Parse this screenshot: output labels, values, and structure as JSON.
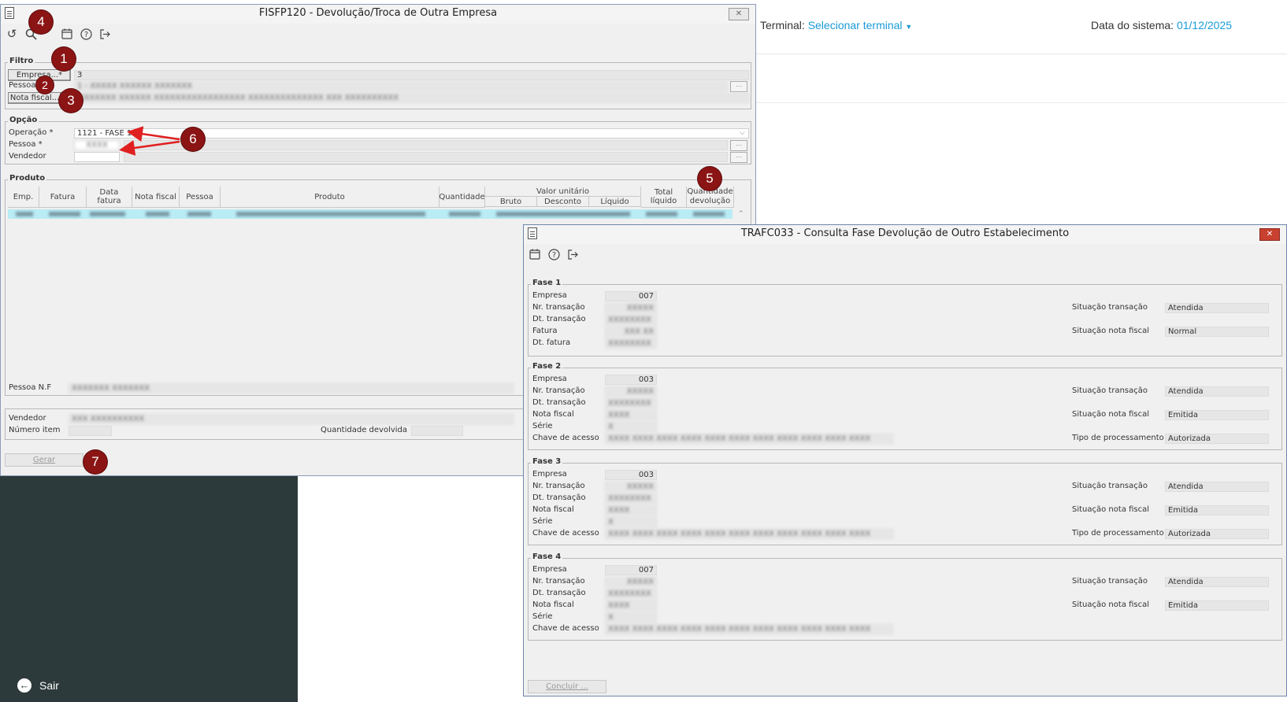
{
  "background": {
    "terminal_label": "Terminal:",
    "terminal_link": "Selecionar terminal",
    "date_label": "Data do sistema:",
    "date_value": "01/12/2025",
    "sair": "Sair"
  },
  "win1": {
    "title": "FISFP120 - Devolução/Troca de Outra Empresa",
    "close": "✕",
    "filtro": {
      "title": "Filtro",
      "empresa_button": "Empresa...*",
      "empresa_value": "3",
      "pessoa_label": "Pessoa",
      "pessoa_value": "1 - XXXXX XXXXXX XXXXXXX",
      "nota_button": "Nota fiscal...",
      "nota_value": "XXXXXXXXX XXXXXX XXXXXXXXXXXXXXXXX XXXXXXXXXXXXXX XXX XXXXXXXXXX"
    },
    "opcao": {
      "title": "Opção",
      "operacao_label": "Operação *",
      "operacao_value": "1121 - FASE 1",
      "pessoa_label": "Pessoa *",
      "pessoa_value": "XXXX",
      "vendedor_label": "Vendedor"
    },
    "produto": {
      "title": "Produto",
      "columns": [
        "Emp.",
        "Fatura",
        "Data fatura",
        "Nota fiscal",
        "Pessoa",
        "Produto",
        "Quantidade",
        "Valor unitário",
        "Total líquido",
        "Quantidade devolução"
      ],
      "sub_columns": [
        "Bruto",
        "Desconto",
        "Líquido"
      ],
      "pessoa_nf_label": "Pessoa N.F",
      "pessoa_nf_value": "XXXXXXX XXXXXXX"
    },
    "bottom": {
      "vendedor_label": "Vendedor",
      "vendedor_value": "XXX XXXXXXXXXX",
      "numero_item_label": "Número item",
      "qtd_devolvida_label": "Quantidade devolvida"
    },
    "gerar": "Gerar"
  },
  "win2": {
    "title": "TRAFC033 - Consulta Fase Devolução de Outro Estabelecimento",
    "close": "✕",
    "labels": {
      "empresa": "Empresa",
      "nr_transacao": "Nr. transação",
      "dt_transacao": "Dt. transação",
      "fatura": "Fatura",
      "dt_fatura": "Dt. fatura",
      "nota_fiscal": "Nota fiscal",
      "serie": "Série",
      "chave": "Chave de acesso",
      "sit_transacao": "Situação transação",
      "sit_nota": "Situação nota fiscal",
      "tipo_proc": "Tipo de processamento"
    },
    "fase1": {
      "title": "Fase 1",
      "empresa": "007",
      "sit_transacao": "Atendida",
      "sit_nota": "Normal"
    },
    "fase2": {
      "title": "Fase 2",
      "empresa": "003",
      "sit_transacao": "Atendida",
      "sit_nota": "Emitida",
      "tipo_proc": "Autorizada"
    },
    "fase3": {
      "title": "Fase 3",
      "empresa": "003",
      "sit_transacao": "Atendida",
      "sit_nota": "Emitida",
      "tipo_proc": "Autorizada"
    },
    "fase4": {
      "title": "Fase 4",
      "empresa": "007",
      "sit_transacao": "Atendida",
      "sit_nota": "Emitida"
    },
    "concluir": "Concluir ..."
  },
  "annotations": [
    "1",
    "2",
    "3",
    "4",
    "5",
    "6",
    "7"
  ],
  "colors": {
    "accent": "#1a9bd7",
    "badge": "#8b1414",
    "arrow": "#e02020",
    "sidebar": "#2d3a3b",
    "selected_row": "#b9ecf5"
  }
}
